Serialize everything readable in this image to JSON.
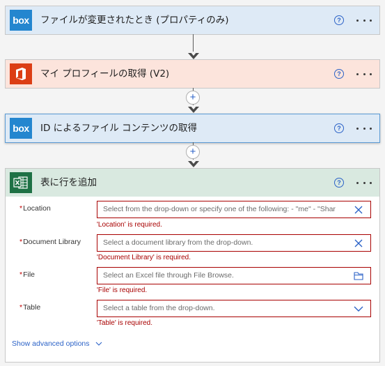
{
  "steps": [
    {
      "title": "ファイルが変更されたとき (プロパティのみ)",
      "logo": "box-logo",
      "bg": "#deeaf6"
    },
    {
      "title": "マイ プロフィールの取得 (V2)",
      "logo": "office-logo",
      "bg": "#fce4dc"
    },
    {
      "title": "ID によるファイル コンテンツの取得",
      "logo": "box-logo",
      "bg": "#deeaf6"
    },
    {
      "title": "表に行を追加",
      "logo": "excel-logo",
      "bg": "#d9e9e0"
    }
  ],
  "logos": {
    "box_text": "box"
  },
  "help_glyph": "?",
  "add_glyph": "+",
  "form": {
    "fields": [
      {
        "required_mark": "*",
        "label": "Location",
        "placeholder": "Select from the drop-down or specify one of the following: - \"me\" - \"Shar",
        "error": "'Location' is required.",
        "icon": "clear-icon"
      },
      {
        "required_mark": "*",
        "label": "Document Library",
        "placeholder": "Select a document library from the drop-down.",
        "error": "'Document Library' is required.",
        "icon": "clear-icon"
      },
      {
        "required_mark": "*",
        "label": "File",
        "placeholder": "Select an Excel file through File Browse.",
        "error": "'File' is required.",
        "icon": "folder-icon"
      },
      {
        "required_mark": "*",
        "label": "Table",
        "placeholder": "Select a table from the drop-down.",
        "error": "'Table' is required.",
        "icon": "chevron-down-icon"
      }
    ],
    "advanced_link": "Show advanced options"
  },
  "colors": {
    "accent": "#2b62c7",
    "error": "#a80000",
    "box_blue": "#0061d5",
    "office_orange": "#dc3e15",
    "excel_green": "#1e7145"
  }
}
